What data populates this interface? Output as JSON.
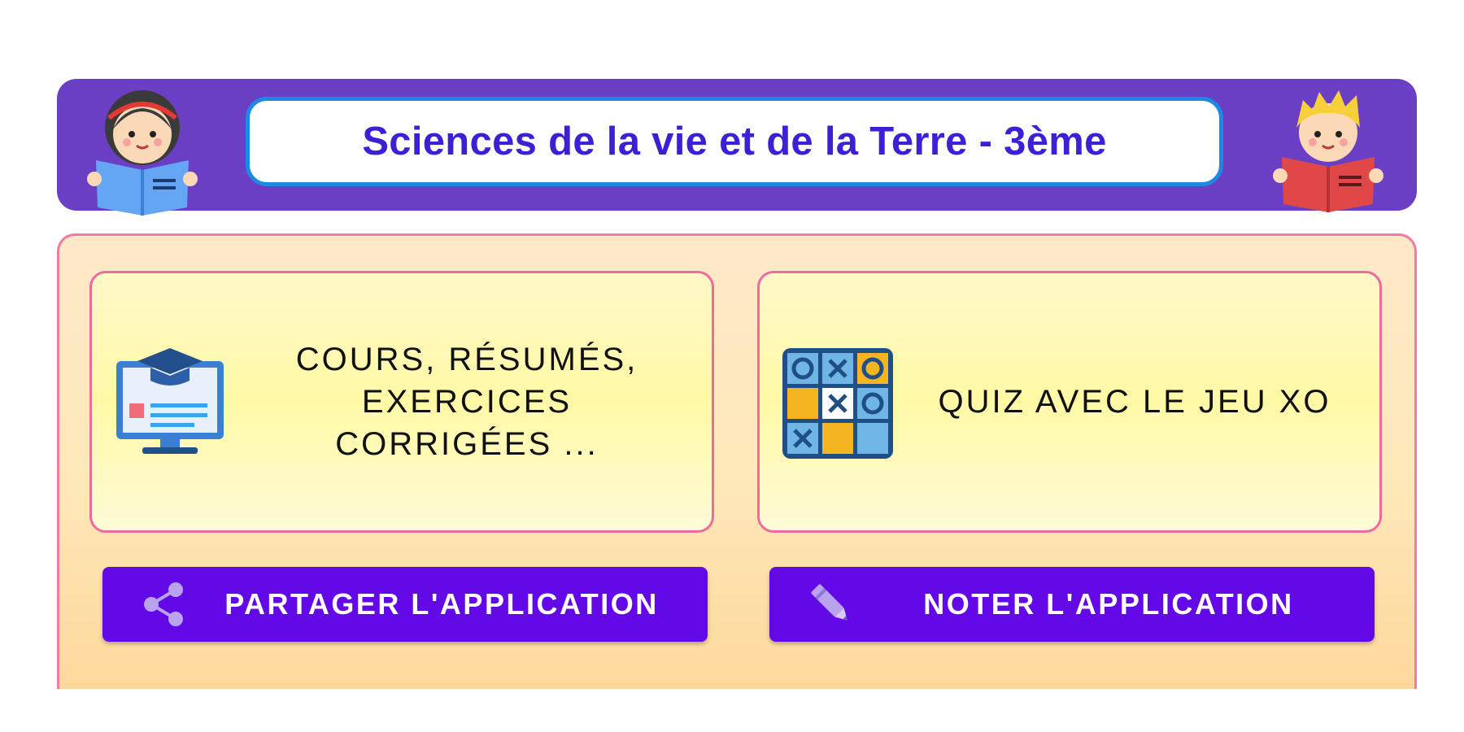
{
  "header": {
    "title": "Sciences de la vie et de la Terre - 3ème",
    "left_avatar_icon": "girl-reading-blue-book-icon",
    "right_avatar_icon": "boy-reading-red-book-icon"
  },
  "cards": [
    {
      "label": "COURS, RÉSUMÉS, EXERCICES CORRIGÉES ...",
      "icon": "graduation-monitor-icon"
    },
    {
      "label": "QUIZ AVEC LE JEU XO",
      "icon": "tic-tac-toe-icon"
    }
  ],
  "buttons": {
    "share": {
      "label": "PARTAGER L'APPLICATION",
      "icon": "share-icon"
    },
    "rate": {
      "label": "NOTER L'APPLICATION",
      "icon": "pencil-icon"
    }
  },
  "colors": {
    "header_bg": "#6a3fc4",
    "title_text": "#3d1fd6",
    "title_border": "#1e88e5",
    "button_bg": "#6308e6",
    "card_border": "#f06aa0",
    "panel_border": "#f27ba3"
  }
}
